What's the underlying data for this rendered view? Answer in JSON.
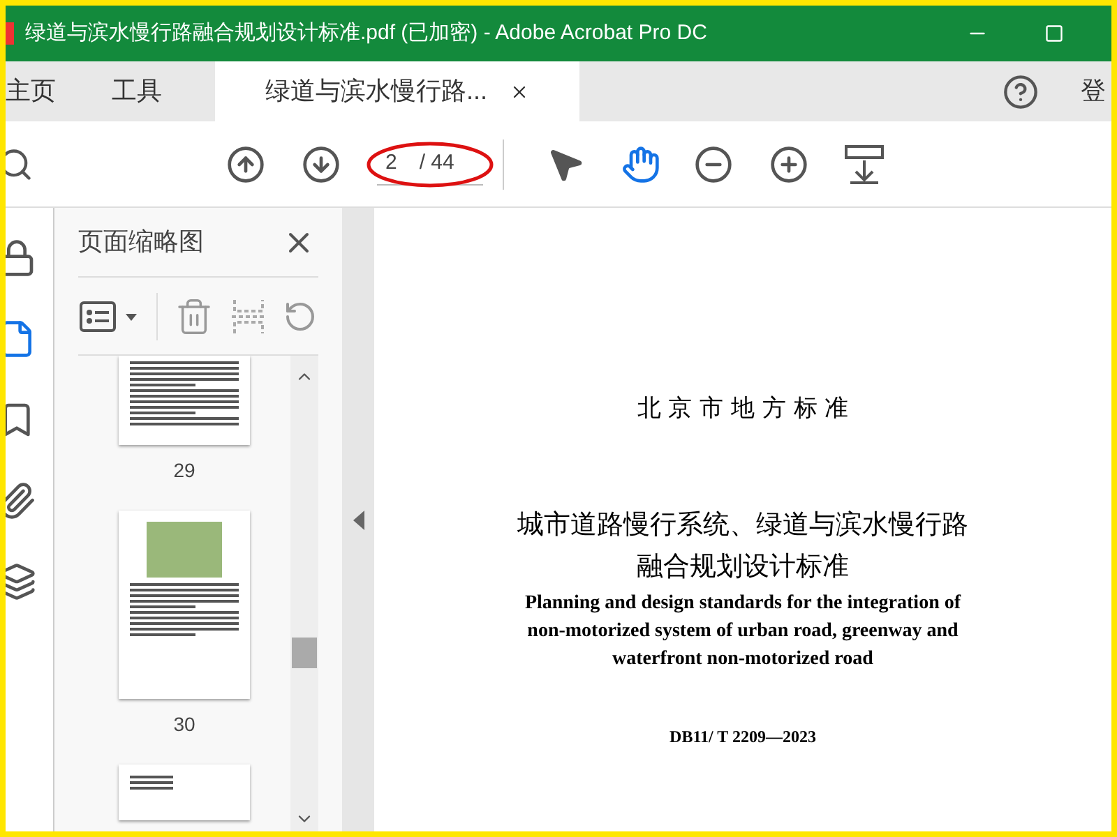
{
  "window": {
    "title": "绿道与滨水慢行路融合规划设计标准.pdf (已加密) - Adobe Acrobat Pro DC"
  },
  "tabs": [
    {
      "label": "主页",
      "kind": "plain",
      "selected": false
    },
    {
      "label": "工具",
      "kind": "plain",
      "selected": false
    },
    {
      "label": "绿道与滨水慢行路...",
      "kind": "document",
      "selected": true
    }
  ],
  "sign_in": "登",
  "toolbar": {
    "page": "2",
    "total": "/ 44",
    "tools": [
      {
        "kind": "select",
        "selected": false
      },
      {
        "kind": "hand",
        "selected": true
      }
    ]
  },
  "nav_rail": [
    {
      "kind": "lock",
      "selected": false
    },
    {
      "kind": "pages",
      "selected": true
    },
    {
      "kind": "bookmark",
      "selected": false
    },
    {
      "kind": "attachment",
      "selected": false
    },
    {
      "kind": "layers",
      "selected": false
    }
  ],
  "panel": {
    "title": "页面缩略图",
    "thumbnails": [
      {
        "kind": "text",
        "label": "29"
      },
      {
        "kind": "figure",
        "label": "30"
      },
      {
        "kind": "heading"
      }
    ]
  },
  "document": {
    "issuer": "北 京 市 地 方 标 准",
    "title_zh": [
      "城市道路慢行系统、绿道与滨水慢行路",
      "融合规划设计标准"
    ],
    "title_en": [
      "Planning and design standards for the integration of",
      "non-motorized system of urban road, greenway and",
      "waterfront non-motorized road"
    ],
    "code": "DB11/ T 2209—2023"
  }
}
